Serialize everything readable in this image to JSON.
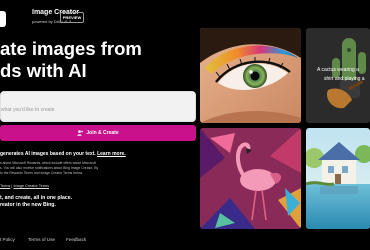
{
  "header": {
    "title": "Image Creator",
    "subtitle": "powered by DALL·E 3",
    "badge": "PREVIEW"
  },
  "hero": {
    "headline_line1": "ate images from",
    "headline_line2": "ds with AI"
  },
  "prompt": {
    "placeholder": "what you'd like to create",
    "value": ""
  },
  "join_button": {
    "label": "Join & Create",
    "icon": "user-add-icon"
  },
  "info": {
    "line1": "generates AI images based on your text.",
    "learn_more": "Learn more.",
    "fine_print_1": "s about Microsoft Rewards, which include offers about Microsoft",
    "fine_print_2": "s. You will also receive notifications about Bing Image Creator. By",
    "fine_print_3": "to the Rewards Terms and Image Creator Terms below."
  },
  "terms": {
    "link1": "Terms",
    "separator": "|",
    "link2": "Image Creator Terms"
  },
  "tagline": {
    "line1": "t, and create, all in one place.",
    "line2": "reator in the new Bing."
  },
  "footer": {
    "privacy": "t Policy",
    "terms_of_use": "Terms of Use",
    "feedback": "Feedback"
  },
  "gallery": {
    "cactus_caption_line1": "A cactus wearing a",
    "cactus_caption_line2": "shirt and playing a"
  },
  "colors": {
    "accent": "#c8118a",
    "background": "#000000",
    "prompt_bg": "#f2f2f2"
  }
}
